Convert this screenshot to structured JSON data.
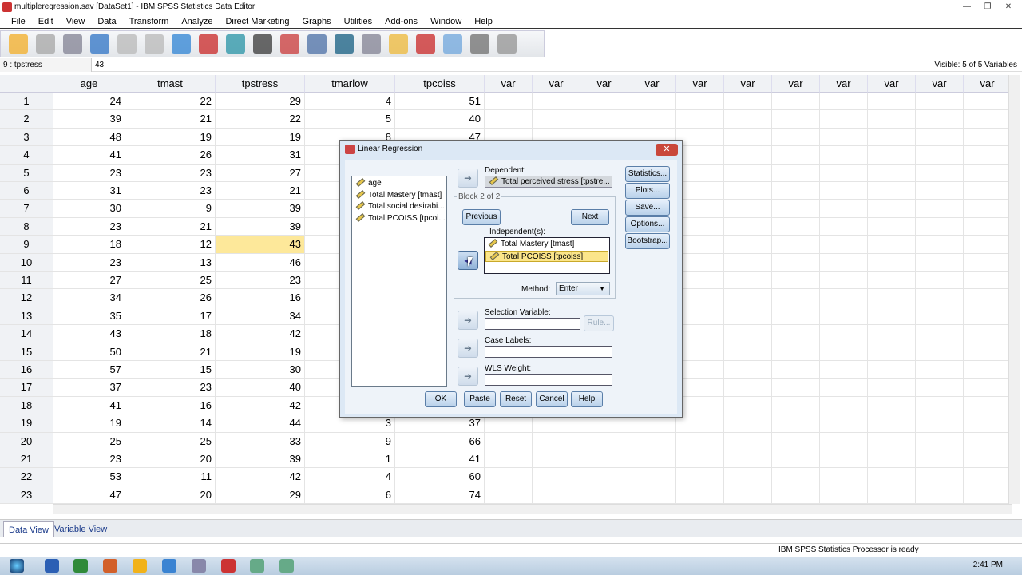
{
  "window": {
    "title": "multipleregression.sav [DataSet1] - IBM SPSS Statistics Data Editor",
    "minimize": "—",
    "maximize": "❐",
    "close": "✕"
  },
  "menu": [
    "File",
    "Edit",
    "View",
    "Data",
    "Transform",
    "Analyze",
    "Direct Marketing",
    "Graphs",
    "Utilities",
    "Add-ons",
    "Window",
    "Help"
  ],
  "toolbar_icons": [
    "open-icon",
    "save-icon",
    "print-icon",
    "recall-dialog-icon",
    "undo-icon",
    "redo-icon",
    "goto-case-icon",
    "goto-variable-icon",
    "variables-icon",
    "find-icon",
    "insert-cases-icon",
    "insert-variable-icon",
    "split-file-icon",
    "weight-cases-icon",
    "select-cases-icon",
    "value-labels-icon",
    "use-sets-icon",
    "show-all-variables-icon",
    "spell-check-icon"
  ],
  "cell_editor": {
    "ref": "9 : tpstress",
    "value": "43",
    "visible": "Visible: 5 of 5 Variables"
  },
  "grid": {
    "columns": [
      "age",
      "tmast",
      "tpstress",
      "tmarlow",
      "tpcoiss",
      "var",
      "var",
      "var",
      "var",
      "var",
      "var",
      "var",
      "var",
      "var",
      "var",
      "var"
    ],
    "rows": [
      [
        "24",
        "22",
        "29",
        "4",
        "51"
      ],
      [
        "39",
        "21",
        "22",
        "5",
        "40"
      ],
      [
        "48",
        "19",
        "19",
        "8",
        "47"
      ],
      [
        "41",
        "26",
        "31",
        "",
        ""
      ],
      [
        "23",
        "23",
        "27",
        "",
        ""
      ],
      [
        "31",
        "23",
        "21",
        "",
        ""
      ],
      [
        "30",
        "9",
        "39",
        "",
        ""
      ],
      [
        "23",
        "21",
        "39",
        "",
        ""
      ],
      [
        "18",
        "12",
        "43",
        "",
        ""
      ],
      [
        "23",
        "13",
        "46",
        "",
        ""
      ],
      [
        "27",
        "25",
        "23",
        "",
        ""
      ],
      [
        "34",
        "26",
        "16",
        "",
        ""
      ],
      [
        "35",
        "17",
        "34",
        "",
        ""
      ],
      [
        "43",
        "18",
        "42",
        "",
        ""
      ],
      [
        "50",
        "21",
        "19",
        "",
        ""
      ],
      [
        "57",
        "15",
        "30",
        "",
        ""
      ],
      [
        "37",
        "23",
        "40",
        "",
        ""
      ],
      [
        "41",
        "16",
        "42",
        "",
        ""
      ],
      [
        "19",
        "14",
        "44",
        "3",
        "37"
      ],
      [
        "25",
        "25",
        "33",
        "9",
        "66"
      ],
      [
        "23",
        "20",
        "39",
        "1",
        "41"
      ],
      [
        "53",
        "11",
        "42",
        "4",
        "60"
      ],
      [
        "47",
        "20",
        "29",
        "6",
        "74"
      ]
    ],
    "selected_row": 9,
    "selected_col": 3
  },
  "tabs": {
    "data_view": "Data View",
    "variable_view": "Variable View"
  },
  "status": "IBM SPSS Statistics Processor is ready",
  "clock": "2:41 PM",
  "dialog": {
    "title": "Linear Regression",
    "close": "✕",
    "source_vars": [
      "age",
      "Total Mastery [tmast]",
      "Total social desirabi...",
      "Total PCOISS [tpcoi..."
    ],
    "dependent_label": "Dependent:",
    "dependent": "Total perceived stress [tpstre...",
    "block": "Block 2 of 2",
    "previous": "Previous",
    "next": "Next",
    "independents_label": "Independent(s):",
    "independents": [
      "Total Mastery [tmast]",
      "Total PCOISS [tpcoiss]"
    ],
    "method_label": "Method:",
    "method": "Enter",
    "selection_label": "Selection Variable:",
    "rule": "Rule...",
    "case_labels": "Case Labels:",
    "wls": "WLS Weight:",
    "side_buttons": [
      "Statistics...",
      "Plots...",
      "Save...",
      "Options...",
      "Bootstrap..."
    ],
    "bottom_buttons": [
      "OK",
      "Paste",
      "Reset",
      "Cancel",
      "Help"
    ],
    "arrow": "➜",
    "arrow_back": "◀"
  }
}
